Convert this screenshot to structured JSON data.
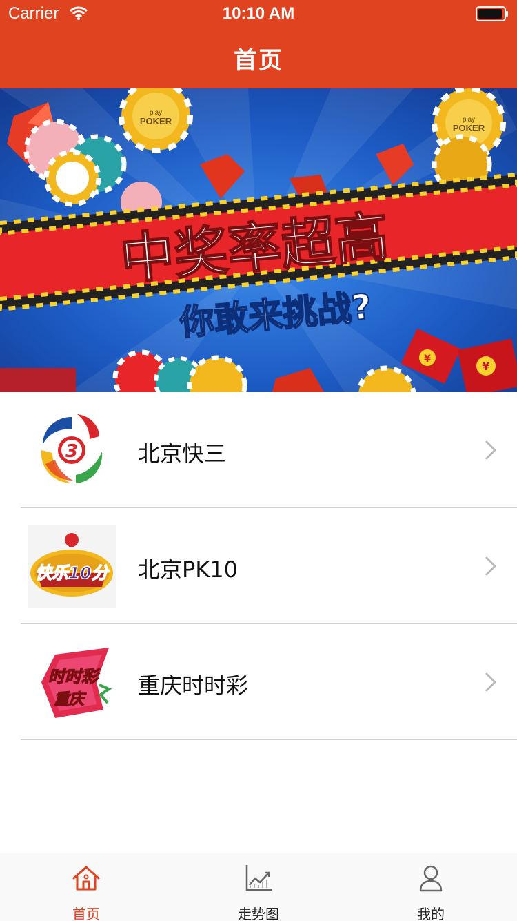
{
  "status_bar": {
    "carrier": "Carrier",
    "time": "10:10 AM"
  },
  "nav": {
    "title": "首页"
  },
  "banner": {
    "headline": "中奖率超高",
    "subline": "你敢来挑战?",
    "chip_text_1": "play",
    "chip_text_2": "POKER",
    "envelope_symbol": "¥"
  },
  "list": {
    "items": [
      {
        "label": "北京快三",
        "icon": "kuai3-logo",
        "logo_text": "3"
      },
      {
        "label": "北京PK10",
        "icon": "kuaile10fen-logo",
        "logo_text": "快乐10分"
      },
      {
        "label": "重庆时时彩",
        "icon": "shishicai-logo",
        "logo_text_1": "时时彩",
        "logo_text_2": "重庆"
      }
    ]
  },
  "tabbar": {
    "tabs": [
      {
        "label": "首页",
        "icon": "home-icon",
        "active": true
      },
      {
        "label": "走势图",
        "icon": "chart-icon",
        "active": false
      },
      {
        "label": "我的",
        "icon": "user-icon",
        "active": false
      }
    ]
  },
  "colors": {
    "accent": "#E0431F",
    "banner_blue": "#1C5BC4",
    "banner_red": "#E8262A",
    "chip_gold": "#F2B81E"
  }
}
